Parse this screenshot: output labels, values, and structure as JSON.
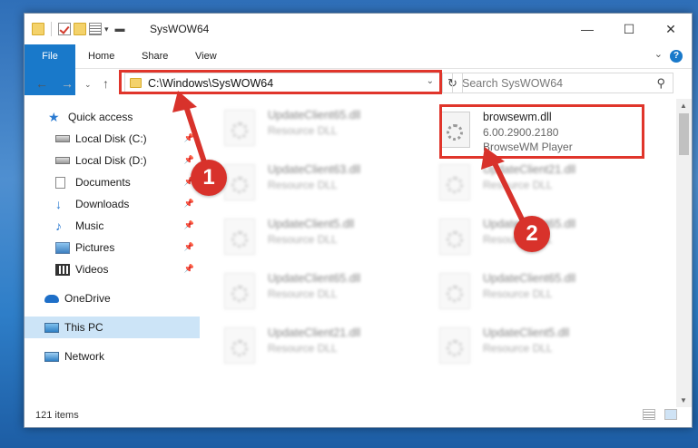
{
  "window": {
    "title": "SysWOW64"
  },
  "ribbon": {
    "tabs": [
      "File",
      "Home",
      "Share",
      "View"
    ],
    "help": "?"
  },
  "address": {
    "path": "C:\\Windows\\SysWOW64"
  },
  "search": {
    "placeholder": "Search SysWOW64"
  },
  "sidebar": {
    "items": [
      {
        "label": "Quick access",
        "icon": "star-icon"
      },
      {
        "label": "Local Disk (C:)",
        "icon": "drive-icon"
      },
      {
        "label": "Local Disk (D:)",
        "icon": "drive-icon"
      },
      {
        "label": "Documents",
        "icon": "documents-icon"
      },
      {
        "label": "Downloads",
        "icon": "downloads-icon"
      },
      {
        "label": "Music",
        "icon": "music-icon"
      },
      {
        "label": "Pictures",
        "icon": "pictures-icon"
      },
      {
        "label": "Videos",
        "icon": "videos-icon"
      },
      {
        "label": "OneDrive",
        "icon": "cloud-icon"
      },
      {
        "label": "This PC",
        "icon": "computer-icon"
      },
      {
        "label": "Network",
        "icon": "network-icon"
      }
    ]
  },
  "files": {
    "highlighted": {
      "name": "browsewm.dll",
      "version": "6.00.2900.2180",
      "description": "BrowseWM Player"
    },
    "left": [
      {
        "name": "UpdateClient65.dll",
        "type": "Resource DLL"
      },
      {
        "name": "UpdateClient63.dll",
        "type": "Resource DLL"
      },
      {
        "name": "UpdateClient5.dll",
        "type": "Resource DLL"
      },
      {
        "name": "UpdateClient65.dll",
        "type": "Resource DLL"
      },
      {
        "name": "UpdateClient21.dll",
        "type": "Resource DLL"
      }
    ],
    "right": [
      {
        "name": "UpdateClient21.dll",
        "type": "Resource DLL"
      },
      {
        "name": "UpdateClient65.dll",
        "type": "Resource DLL"
      },
      {
        "name": "UpdateClient65.dll",
        "type": "Resource DLL"
      },
      {
        "name": "UpdateClient5.dll",
        "type": "Resource DLL"
      }
    ]
  },
  "status": {
    "count": "121 items"
  },
  "annotations": {
    "step1": "1",
    "step2": "2",
    "color": "#d8322b"
  }
}
